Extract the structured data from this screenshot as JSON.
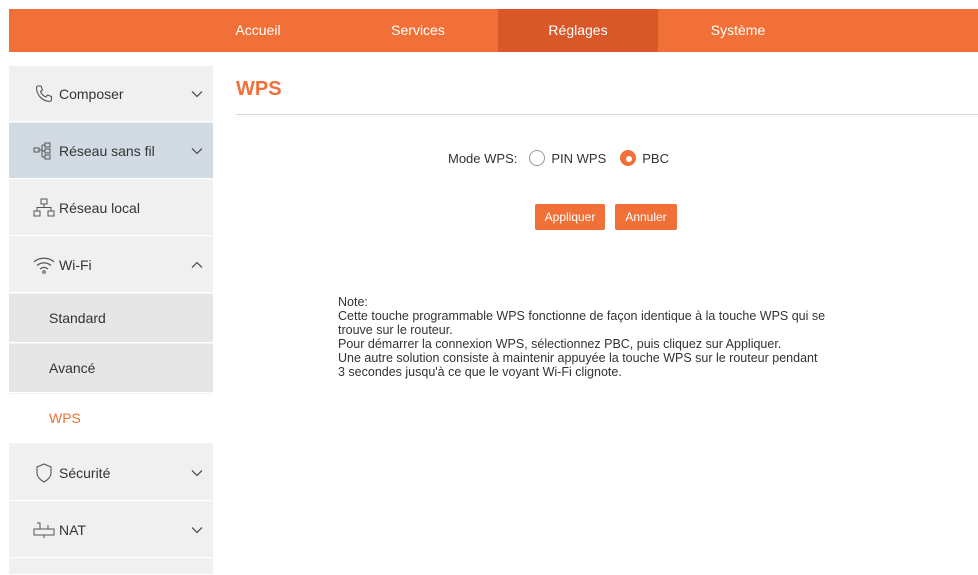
{
  "top_nav": {
    "tabs": [
      {
        "label": "Accueil"
      },
      {
        "label": "Services"
      },
      {
        "label": "Réglages"
      },
      {
        "label": "Système"
      }
    ],
    "active_tab": "Réglages"
  },
  "sidebar": {
    "items": [
      {
        "label": "Composer",
        "icon": "phone-icon",
        "expanded": false
      },
      {
        "label": "Réseau sans fil",
        "icon": "network-nodes-icon",
        "expanded": false,
        "selected": true
      },
      {
        "label": "Réseau local",
        "icon": "lan-icon"
      },
      {
        "label": "Wi-Fi",
        "icon": "wifi-icon",
        "expanded": true
      },
      {
        "label": "Sécurité",
        "icon": "shield-icon",
        "expanded": false
      },
      {
        "label": "NAT",
        "icon": "nat-icon",
        "expanded": false
      }
    ],
    "wifi_subitems": [
      {
        "label": "Standard"
      },
      {
        "label": "Avancé"
      },
      {
        "label": "WPS",
        "active": true
      }
    ]
  },
  "main": {
    "title": "WPS",
    "mode_label": "Mode WPS:",
    "options": [
      {
        "label": "PIN WPS",
        "checked": false
      },
      {
        "label": "PBC",
        "checked": true
      }
    ],
    "apply_label": "Appliquer",
    "cancel_label": "Annuler",
    "note": {
      "lines": [
        "Note:",
        "Cette touche programmable WPS fonctionne de façon identique à la touche WPS qui se",
        "trouve sur le routeur.",
        "Pour démarrer la connexion WPS, sélectionnez PBC, puis cliquez sur Appliquer.",
        "Une autre solution consiste à maintenir appuyée la touche WPS sur le routeur pendant",
        "3 secondes jusqu'à ce que le voyant Wi-Fi clignote."
      ]
    }
  },
  "colors": {
    "accent": "#f07038",
    "accent_dark": "#d9582a",
    "sidebar_bg": "#f0f0f0",
    "sidebar_selected": "#d2dbe3"
  }
}
